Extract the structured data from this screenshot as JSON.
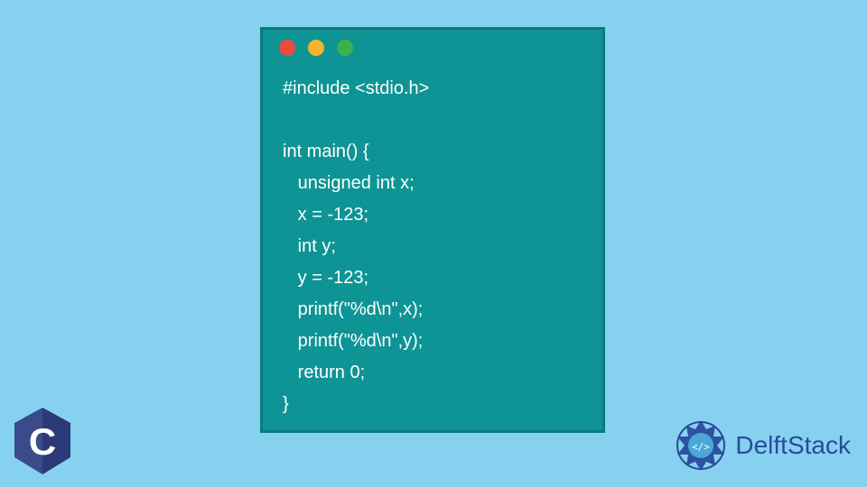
{
  "code": {
    "lines": [
      "#include <stdio.h>",
      "",
      "int main() {",
      "   unsigned int x;",
      "   x = -123;",
      "   int y;",
      "   y = -123;",
      "   printf(\"%d\\n\",x);",
      "   printf(\"%d\\n\",y);",
      "   return 0;",
      "}"
    ]
  },
  "window": {
    "dot_colors": [
      "#e94b3c",
      "#f5b32e",
      "#3cb04b"
    ]
  },
  "logos": {
    "c_letter": "C",
    "delftstack_text": "DelftStack"
  },
  "colors": {
    "background": "#87d1f0",
    "window": "#0f9495",
    "window_border": "#0a7a7b",
    "code_text": "#ffffff",
    "delft_blue": "#2a4a9c"
  }
}
